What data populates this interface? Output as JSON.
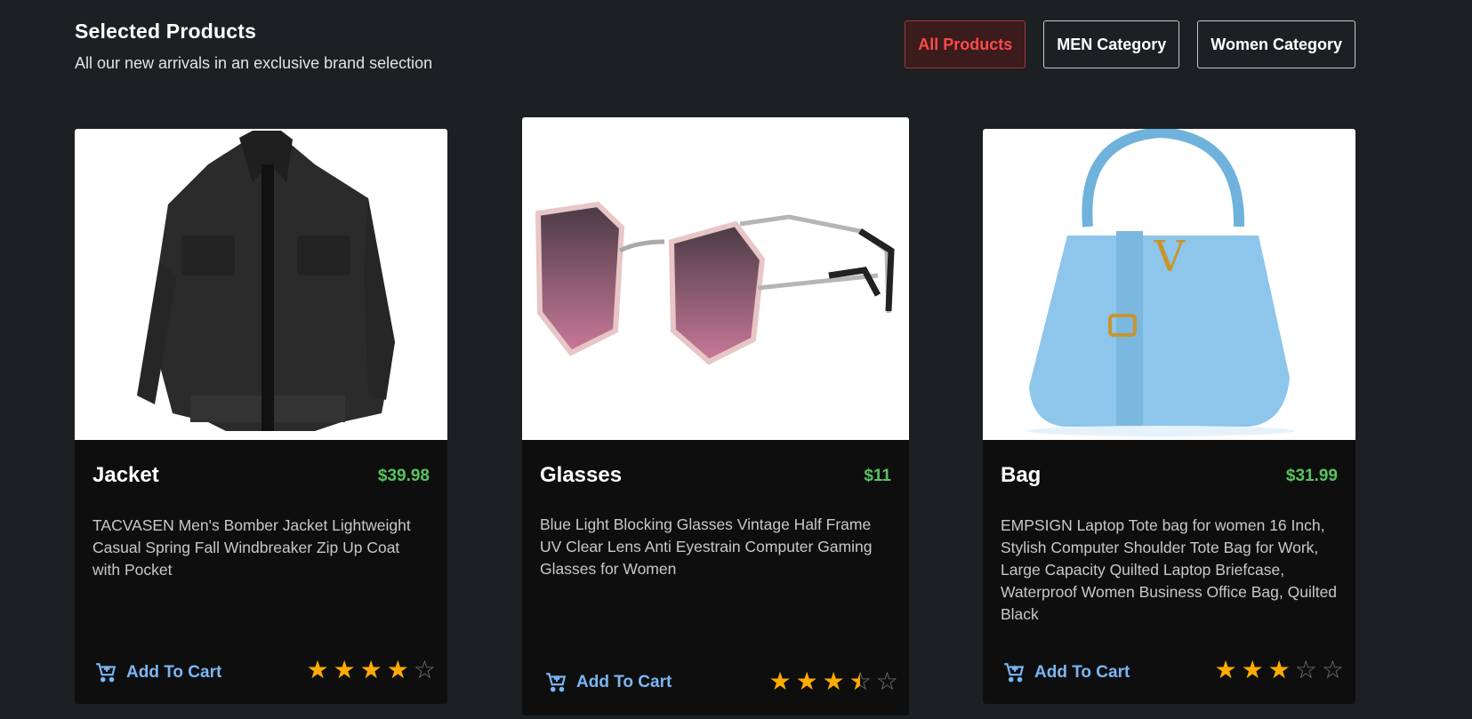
{
  "header": {
    "title": "Selected Products",
    "subtitle": "All our new arrivals in an exclusive brand selection"
  },
  "filters": [
    {
      "label": "All Products",
      "active": true
    },
    {
      "label": "MEN Category",
      "active": false
    },
    {
      "label": "Women Category",
      "active": false
    }
  ],
  "products": [
    {
      "title": "Jacket",
      "price": "$39.98",
      "description": "TACVASEN Men's Bomber Jacket Lightweight Casual Spring Fall Windbreaker Zip Up Coat with Pocket",
      "cart_label": "Add To Cart",
      "rating": 4,
      "rating_max": 5
    },
    {
      "title": "Glasses",
      "price": "$11",
      "description": "Blue Light Blocking Glasses Vintage Half Frame UV Clear Lens Anti Eyestrain Computer Gaming Glasses for Women",
      "cart_label": "Add To Cart",
      "rating": 3.5,
      "rating_max": 5
    },
    {
      "title": "Bag",
      "price": "$31.99",
      "description": "EMPSIGN Laptop Tote bag for women 16 Inch, Stylish Computer Shoulder Tote Bag for Work, Large Capacity Quilted Laptop Briefcase, Waterproof Women Business Office Bag, Quilted Black",
      "cart_label": "Add To Cart",
      "rating": 3,
      "rating_max": 5
    }
  ],
  "colors": {
    "background": "#1d2022",
    "accent_red": "#ff4a4a",
    "price_green": "#58c35e",
    "link_blue": "#7bb6f2",
    "star": "#ffac00"
  }
}
